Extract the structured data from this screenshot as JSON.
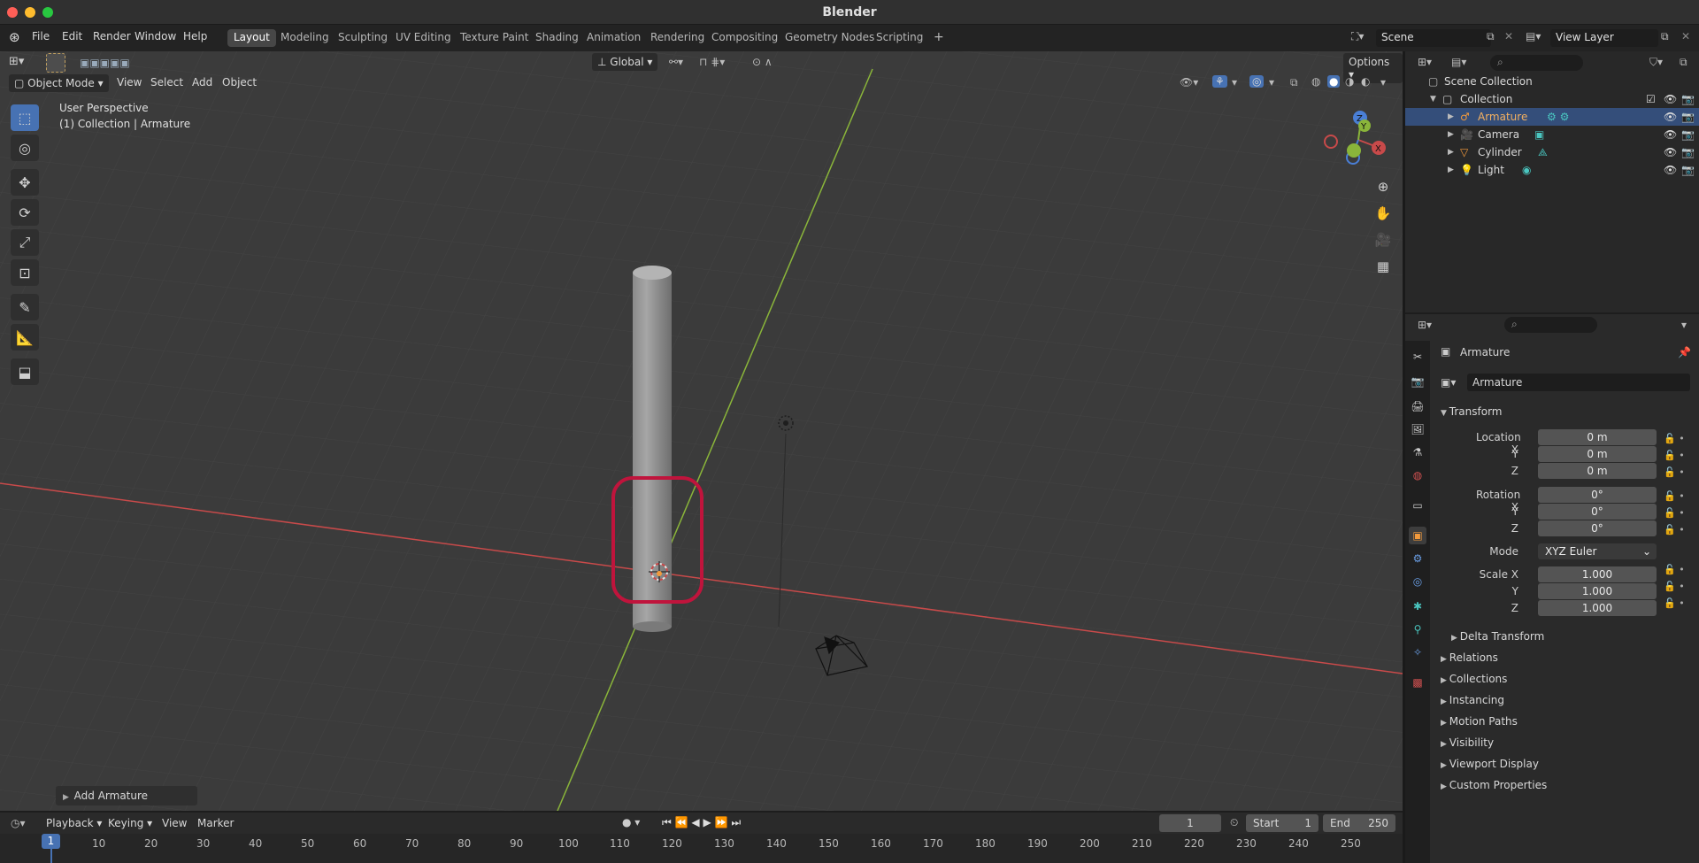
{
  "window": {
    "title": "Blender"
  },
  "menu": [
    "File",
    "Edit",
    "Render",
    "Window",
    "Help"
  ],
  "workspaces": [
    "Layout",
    "Modeling",
    "Sculpting",
    "UV Editing",
    "Texture Paint",
    "Shading",
    "Animation",
    "Rendering",
    "Compositing",
    "Geometry Nodes",
    "Scripting"
  ],
  "active_workspace": "Layout",
  "scene": {
    "name": "Scene",
    "view_layer": "View Layer"
  },
  "viewport": {
    "mode": "Object Mode",
    "menus": [
      "View",
      "Select",
      "Add",
      "Object"
    ],
    "transform_orientation": "Global",
    "options_label": "Options",
    "perspective_label": "User Perspective",
    "collection_label": "(1) Collection | Armature",
    "gizmo_axes": [
      "X",
      "Y",
      "Z"
    ],
    "last_operator": "Add Armature"
  },
  "outliner": {
    "root": "Scene Collection",
    "collection": "Collection",
    "items": [
      {
        "name": "Armature",
        "selected": true
      },
      {
        "name": "Camera",
        "selected": false
      },
      {
        "name": "Cylinder",
        "selected": false
      },
      {
        "name": "Light",
        "selected": false
      }
    ]
  },
  "properties": {
    "object_name": "Armature",
    "datablock_name": "Armature",
    "transform_label": "Transform",
    "location": {
      "label": "Location X",
      "x": "0 m",
      "y": "0 m",
      "z": "0 m"
    },
    "rotation": {
      "label": "Rotation X",
      "x": "0°",
      "y": "0°",
      "z": "0°"
    },
    "mode_label": "Mode",
    "mode_value": "XYZ Euler",
    "scale": {
      "label": "Scale X",
      "x": "1.000",
      "y": "1.000",
      "z": "1.000"
    },
    "axis_y": "Y",
    "axis_z": "Z",
    "delta_transform": "Delta Transform",
    "sections": [
      "Relations",
      "Collections",
      "Instancing",
      "Motion Paths",
      "Visibility",
      "Viewport Display",
      "Custom Properties"
    ]
  },
  "timeline": {
    "menus": [
      "Playback",
      "Keying",
      "View",
      "Marker"
    ],
    "current_frame": "1",
    "start_label": "Start",
    "start": "1",
    "end_label": "End",
    "end": "250",
    "ticks": [
      "1",
      "10",
      "20",
      "30",
      "40",
      "50",
      "60",
      "70",
      "80",
      "90",
      "100",
      "110",
      "120",
      "130",
      "140",
      "150",
      "160",
      "170",
      "180",
      "190",
      "200",
      "210",
      "220",
      "230",
      "240",
      "250"
    ]
  },
  "colors": {
    "accent": "#4772b3",
    "x_axis": "#c84a4a",
    "y_axis": "#8ab53a",
    "z_axis": "#4a7fd6",
    "highlight": "#c0143c",
    "selected_object": "#f39a3c"
  }
}
